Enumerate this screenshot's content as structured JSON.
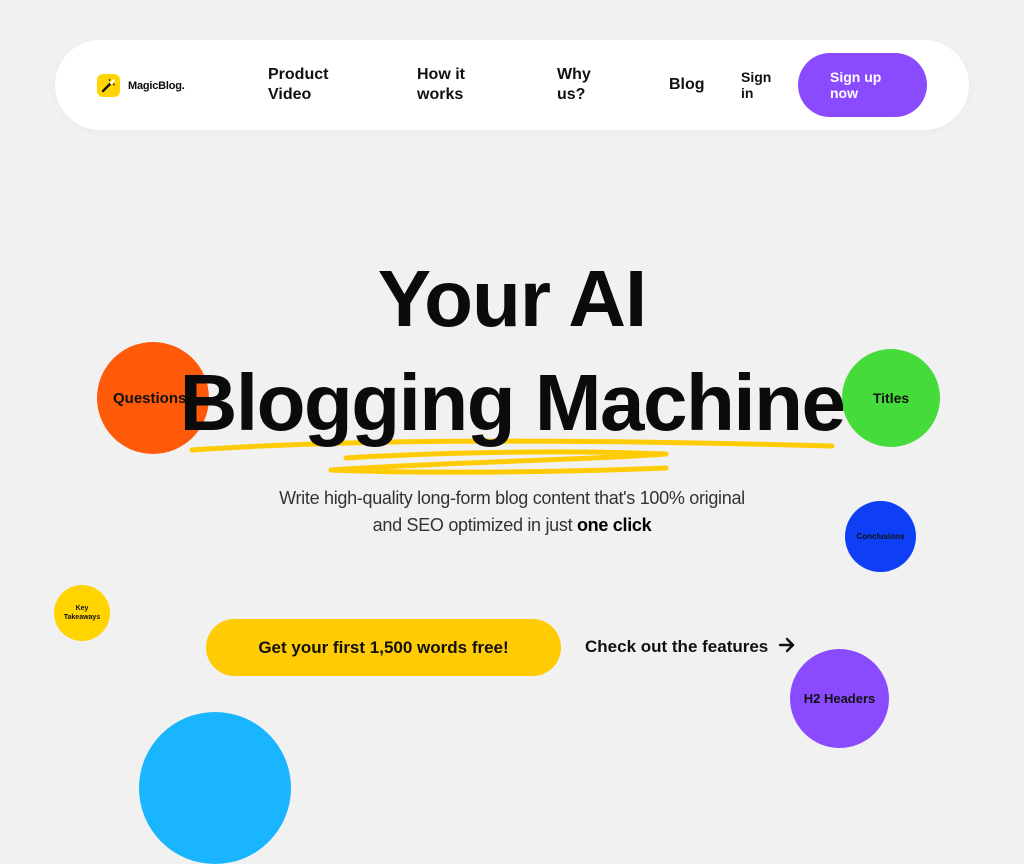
{
  "nav": {
    "logo_text": "MagicBlog.",
    "links": [
      {
        "label": "Product\nVideo"
      },
      {
        "label": "How it\nworks"
      },
      {
        "label": "Why\nus?"
      },
      {
        "label": "Blog"
      }
    ],
    "sign_in": "Sign\nin",
    "sign_up": "Sign up now"
  },
  "hero": {
    "line1": "Your AI",
    "line2": "Blogging Machine",
    "subtitle_line1": "Write high-quality long-form blog content that's 100% original",
    "subtitle_line2_prefix": "and SEO optimized in just ",
    "subtitle_line2_bold": "one click"
  },
  "bubbles": {
    "questions": "Questions",
    "titles": "Titles",
    "conclusions": "Conclusions",
    "key_takeaways": "Key Takeaways",
    "h2_headers": "H2 Headers"
  },
  "cta": {
    "primary": "Get your first 1,500 words free!",
    "secondary": "Check out the features"
  },
  "colors": {
    "accent_purple": "#8a4bff",
    "accent_yellow": "#ffcb05",
    "bubble_orange": "#ff5a0a",
    "bubble_green": "#45db3b",
    "bubble_blue": "#0e3ff5",
    "bubble_sky": "#1ab5ff"
  },
  "icons": {
    "logo": "magic-wand-icon",
    "cta_arrow": "arrow-right-icon"
  }
}
